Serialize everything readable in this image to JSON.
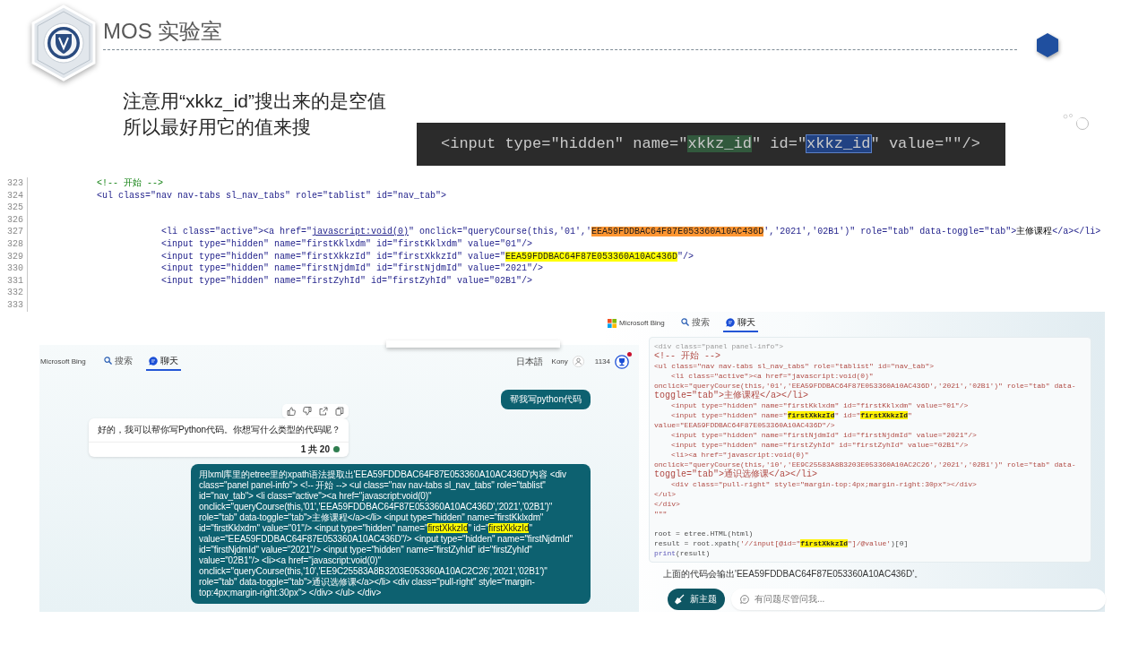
{
  "slide": {
    "title": "MOS 实验室"
  },
  "note": {
    "lines": [
      "注意用“xkkz_id”搜出来的是空值",
      "所以最好用它的值来搜"
    ]
  },
  "code_snippet": {
    "segments": [
      {
        "kind": "plain",
        "text": "<input type=\"hidden\" name=\""
      },
      {
        "kind": "match",
        "text": "xkkz_id"
      },
      {
        "kind": "plain",
        "text": "\" id=\""
      },
      {
        "kind": "selection",
        "text": "xkkz_id"
      },
      {
        "kind": "plain",
        "text": "\" value=\"\"/>"
      }
    ]
  },
  "code_listing": {
    "lines": [
      {
        "number": "323",
        "segments": [
          {
            "kind": "comment",
            "text": "<!-- 开始 -->"
          }
        ]
      },
      {
        "number": "324",
        "segments": [
          {
            "kind": "markup",
            "text": "<ul class=\"nav nav-tabs sl_nav_tabs\" role=\"tablist\" id=\"nav_tab\">"
          }
        ],
        "children": [
          {
            "number": "325"
          },
          {
            "number": "326"
          },
          {
            "number": "327",
            "segments": [
              {
                "kind": "markup",
                "text": "<li class=\"active\"><a href=\""
              },
              {
                "kind": "link",
                "text": "javascript:void(0)"
              },
              {
                "kind": "markup",
                "text": "\" onclick=\"queryCourse(this,'01','"
              },
              {
                "kind": "highlight",
                "color": "#ff9632",
                "text": "EEA59FDDBAC64F87E053360A10AC436D"
              },
              {
                "kind": "markup",
                "text": "','2021','02B1')\" role=\"tab\" data-toggle=\"tab\">"
              },
              {
                "kind": "content",
                "text": "主修课程"
              },
              {
                "kind": "markup",
                "text": "</a></li>"
              }
            ]
          },
          {
            "number": "328",
            "segments": [
              {
                "kind": "markup",
                "text": "<input type=\"hidden\" name=\"firstKklxdm\" id=\"firstKklxdm\" value=\"01\"/>"
              }
            ]
          },
          {
            "number": "329",
            "segments": [
              {
                "kind": "markup",
                "text": "<input type=\"hidden\" name=\"firstXkkzId\" id=\"firstXkkzId\" value=\""
              },
              {
                "kind": "highlight",
                "color": "#ffff00",
                "text": "EEA59FDDBAC64F87E053360A10AC436D"
              },
              {
                "kind": "markup",
                "text": "\"/>"
              }
            ]
          },
          {
            "number": "330",
            "segments": [
              {
                "kind": "markup",
                "text": "<input type=\"hidden\" name=\"firstNjdmId\" id=\"firstNjdmId\" value=\"2021\"/>"
              }
            ]
          },
          {
            "number": "331",
            "segments": [
              {
                "kind": "markup",
                "text": "<input type=\"hidden\" name=\"firstZyhId\" id=\"firstZyhId\" value=\"02B1\"/>"
              }
            ]
          },
          {
            "number": "332"
          },
          {
            "number": "333"
          }
        ]
      }
    ]
  },
  "chat_left": {
    "brand": "Microsoft Bing",
    "tabs": [
      {
        "kind": "search",
        "label": "搜索",
        "selected": false
      },
      {
        "kind": "chat",
        "label": "聊天",
        "selected": true
      }
    ],
    "language": "日本語",
    "user": "Kony",
    "points": "1134",
    "notification_dot": true,
    "messages": [
      {
        "kind": "user",
        "segments": [
          {
            "kind": "plain",
            "text": "帮我写python代码"
          }
        ]
      },
      {
        "kind": "bot",
        "segments": [
          {
            "kind": "plain",
            "text": "好的，我可以帮你写Python代码。你想写什么类型的代码呢？"
          }
        ],
        "footer": "1 共 20"
      },
      {
        "kind": "user",
        "segments": [
          {
            "kind": "plain",
            "text": "用lxml库里的etree里的xpath语法提取出'EEA59FDDBAC64F87E053360A10AC436D'内容 <div class=\"panel panel-info\"> <!-- 开始 --> <ul class=\"nav nav-tabs sl_nav_tabs\" role=\"tablist\" id=\"nav_tab\"> <li class=\"active\"><a href=\"javascript:void(0)\" onclick=\"queryCourse(this,'01','EEA59FDDBAC64F87E053360A10AC436D','2021','02B1')\" role=\"tab\" data-toggle=\"tab\">主修课程</a></li> <input type=\"hidden\" name=\"firstKklxdm\" id=\"firstKklxdm\" value=\"01\"/> <input type=\"hidden\" name=\""
          },
          {
            "kind": "highlight",
            "text": "firstXkkzId"
          },
          {
            "kind": "plain",
            "text": "\" id=\""
          },
          {
            "kind": "highlight",
            "text": "firstXkkzId"
          },
          {
            "kind": "plain",
            "text": "\" value=\"EEA59FDDBAC64F87E053360A10AC436D\"/> <input type=\"hidden\" name=\"firstNjdmId\" id=\"firstNjdmId\" value=\"2021\"/> <input type=\"hidden\" name=\"firstZyhId\" id=\"firstZyhId\" value=\"02B1\"/> <li><a href=\"javascript:void(0)\" onclick=\"queryCourse(this,'10','EE9C25583A8B3203E053360A10AC2C26','2021','02B1')\" role=\"tab\" data-toggle=\"tab\">通识选修课</a></li> <div class=\"pull-right\" style=\"margin-top:4px;margin-right:30px\"> </div> </ul> </div>"
          }
        ]
      }
    ]
  },
  "chat_right": {
    "brand": "Microsoft Bing",
    "tabs": [
      {
        "kind": "search",
        "label": "搜索",
        "selected": false
      },
      {
        "kind": "chat",
        "label": "聊天",
        "selected": true
      }
    ],
    "code_blocks": [
      {
        "lines": [
          {
            "segments": [
              {
                "kind": "faded",
                "text": "<div class=\"panel panel-info\">"
              }
            ]
          },
          {
            "segments": [
              {
                "kind": "string",
                "text": "<!-- 开始 -->"
              }
            ]
          },
          {
            "segments": [
              {
                "kind": "string",
                "text": "<ul class=\"nav nav-tabs sl_nav_tabs\" role=\"tablist\" id=\"nav_tab\">"
              }
            ],
            "children": [
              {
                "segments": [
                  {
                    "kind": "string",
                    "text": "<li class=\"active\"><a href=\"javascript:void(0)\""
                  }
                ]
              }
            ]
          },
          {
            "segments": [
              {
                "kind": "string",
                "text": "onclick=\"queryCourse(this,'01','EEA59FDDBAC64F87E053360A10AC436D','2021','02B1')\" role=\"tab\" data-"
              }
            ]
          },
          {
            "segments": [
              {
                "kind": "string",
                "text": "toggle=\"tab\">主修课程</a></li>"
              }
            ],
            "children": [
              {
                "segments": [
                  {
                    "kind": "string",
                    "text": "<input type=\"hidden\" name=\"firstKklxdm\" id=\"firstKklxdm\" value=\"01\"/>"
                  }
                ]
              },
              {
                "segments": [
                  {
                    "kind": "string",
                    "text": "<input type=\"hidden\" name=\""
                  },
                  {
                    "kind": "highlight",
                    "text": "firstXkkzId"
                  },
                  {
                    "kind": "string",
                    "text": "\" id=\""
                  },
                  {
                    "kind": "highlight",
                    "text": "firstXkkzId"
                  },
                  {
                    "kind": "string",
                    "text": "\""
                  }
                ]
              }
            ]
          },
          {
            "segments": [
              {
                "kind": "string",
                "text": "value=\"EEA59FDDBAC64F87E053360A10AC436D\"/>"
              }
            ],
            "children": [
              {
                "segments": [
                  {
                    "kind": "string",
                    "text": "<input type=\"hidden\" name=\"firstNjdmId\" id=\"firstNjdmId\" value=\"2021\"/>"
                  }
                ]
              },
              {
                "segments": [
                  {
                    "kind": "string",
                    "text": "<input type=\"hidden\" name=\"firstZyhId\" id=\"firstZyhId\" value=\"02B1\"/>"
                  }
                ]
              },
              {
                "segments": [
                  {
                    "kind": "string",
                    "text": "<li><a href=\"javascript:void(0)\""
                  }
                ]
              }
            ]
          },
          {
            "segments": [
              {
                "kind": "string",
                "text": "onclick=\"queryCourse(this,'10','EE9C25583A8B3203E053360A10AC2C26','2021','02B1')\" role=\"tab\" data-"
              }
            ]
          },
          {
            "segments": [
              {
                "kind": "string",
                "text": "toggle=\"tab\">通识选修课</a></li>"
              }
            ],
            "children": [
              {
                "segments": [
                  {
                    "kind": "string",
                    "text": "<div class=\"pull-right\" style=\"margin-top:4px;margin-right:30px\"></div>"
                  }
                ]
              }
            ]
          },
          {
            "segments": [
              {
                "kind": "string",
                "text": "</ul>"
              }
            ]
          },
          {
            "segments": [
              {
                "kind": "string",
                "text": "</div>"
              }
            ]
          },
          {
            "segments": [
              {
                "kind": "string",
                "text": "\"\"\""
              }
            ]
          }
        ]
      },
      {
        "lines": [
          {
            "segments": [
              {
                "kind": "code",
                "text": "root = etree.HTML(html)"
              }
            ]
          },
          {
            "segments": [
              {
                "kind": "code",
                "text": "result = root.xpath("
              },
              {
                "kind": "string",
                "text": "'//input[@id=\""
              },
              {
                "kind": "highlight",
                "text": "firstXkkzId"
              },
              {
                "kind": "string",
                "text": "\"]/@value'"
              },
              {
                "kind": "code",
                "text": ")[0]"
              }
            ]
          },
          {
            "segments": [
              {
                "kind": "keyword",
                "text": "print"
              },
              {
                "kind": "code",
                "text": "(result)"
              }
            ]
          }
        ]
      }
    ],
    "answer": "上面的代码会输出'EEA59FDDBAC64F87E053360A10AC436D'。",
    "new_topic_button": "新主题",
    "input": {
      "placeholder": "有问题尽管问我..."
    }
  }
}
